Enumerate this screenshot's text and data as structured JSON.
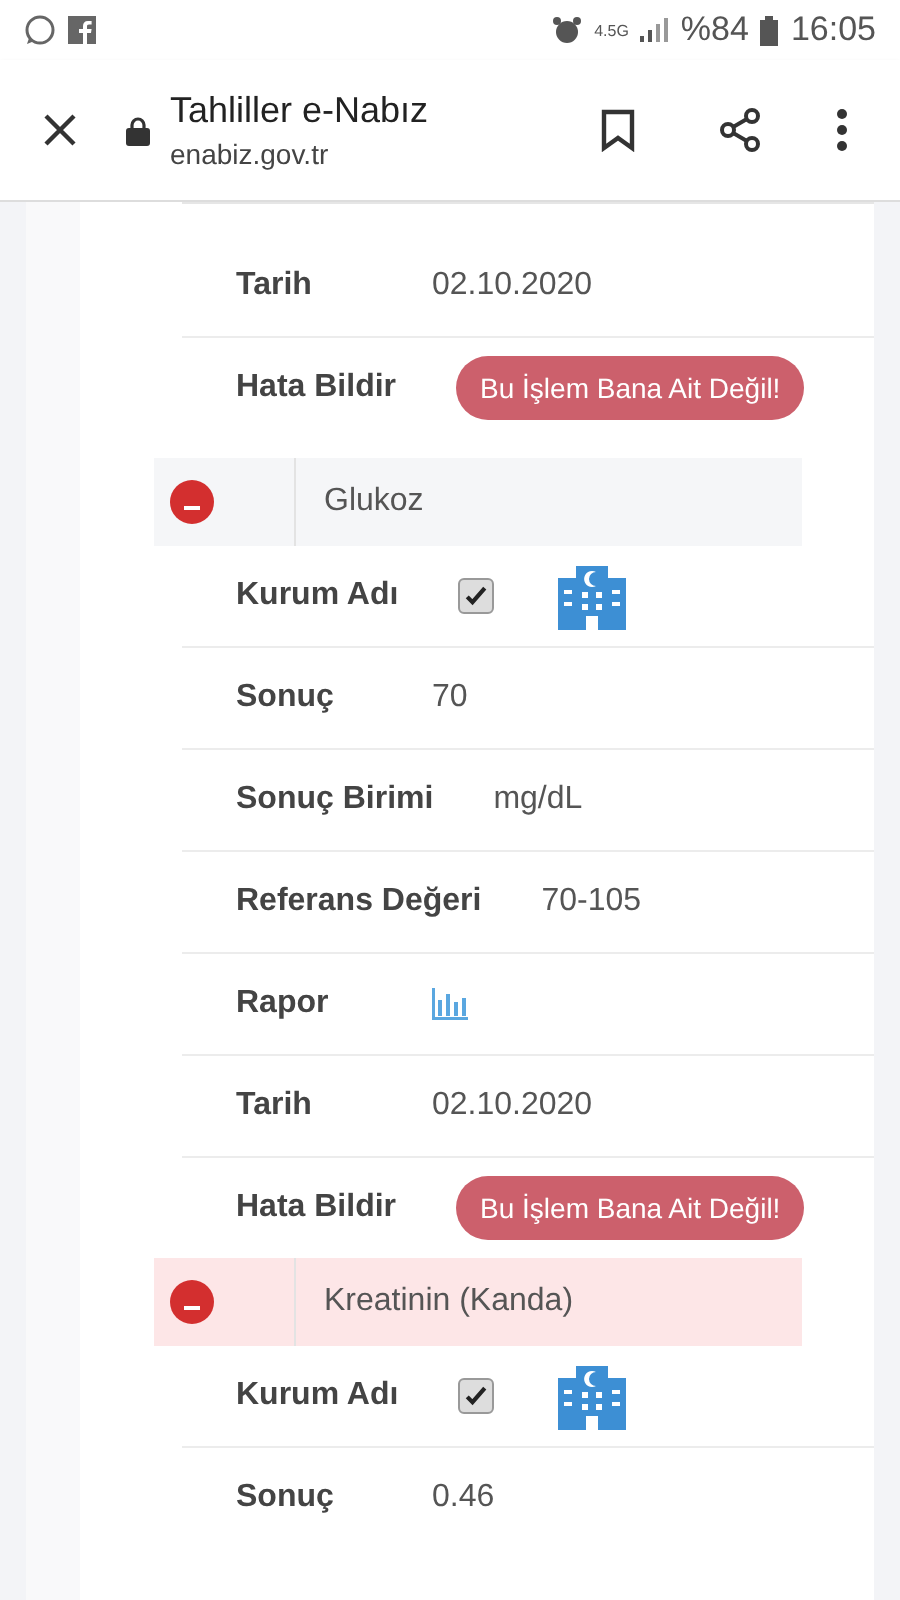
{
  "status_bar": {
    "network": "4.5G",
    "battery": "%84",
    "time": "16:05"
  },
  "browser": {
    "title": "Tahliller e-Nabız",
    "url": "enabiz.gov.tr"
  },
  "previous_test_fields": [
    {
      "kind": "text",
      "label": "Tarih",
      "value": "02.10.2020"
    },
    {
      "kind": "button",
      "label": "Hata Bildir",
      "button": "Bu İşlem Bana Ait Değil!"
    }
  ],
  "tests": [
    {
      "name": "Glukoz",
      "highlighted": false,
      "fields": [
        {
          "kind": "checkbox",
          "label": "Kurum Adı",
          "checked": true
        },
        {
          "kind": "text",
          "label": "Sonuç",
          "value": "70"
        },
        {
          "kind": "text",
          "label": "Sonuç Birimi",
          "value": "mg/dL"
        },
        {
          "kind": "text",
          "label": "Referans Değeri",
          "value": "70-105"
        },
        {
          "kind": "report",
          "label": "Rapor"
        },
        {
          "kind": "text",
          "label": "Tarih",
          "value": "02.10.2020"
        },
        {
          "kind": "button",
          "label": "Hata Bildir",
          "button": "Bu İşlem Bana Ait Değil!"
        }
      ]
    },
    {
      "name": "Kreatinin (Kanda)",
      "highlighted": true,
      "fields": [
        {
          "kind": "checkbox",
          "label": "Kurum Adı",
          "checked": true
        },
        {
          "kind": "text",
          "label": "Sonuç",
          "value": "0.46"
        }
      ]
    }
  ]
}
